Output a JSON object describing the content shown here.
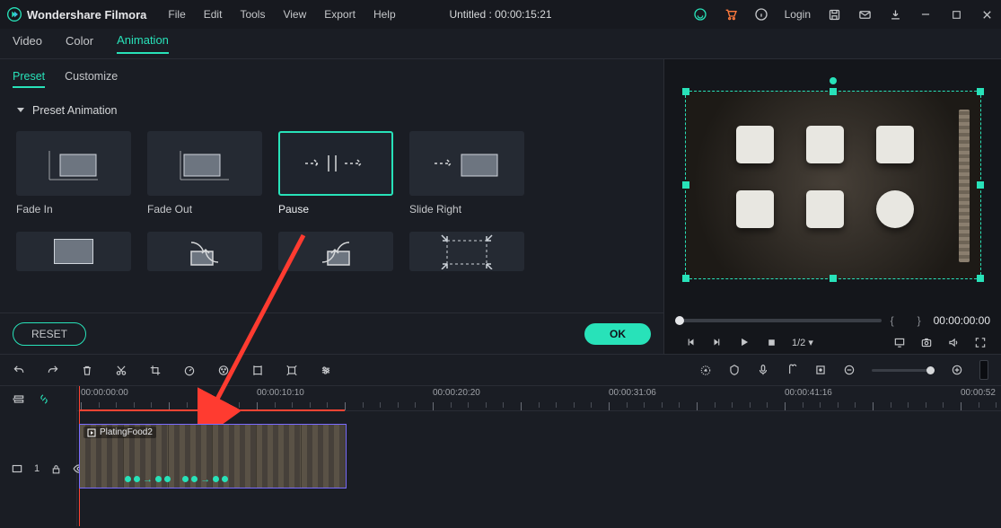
{
  "titlebar": {
    "app_name": "Wondershare Filmora",
    "menu": [
      "File",
      "Edit",
      "Tools",
      "View",
      "Export",
      "Help"
    ],
    "document_title": "Untitled : 00:00:15:21",
    "login": "Login"
  },
  "primary_tabs": {
    "video": "Video",
    "color": "Color",
    "animation": "Animation"
  },
  "subtabs": {
    "preset": "Preset",
    "customize": "Customize"
  },
  "section": {
    "preset_animation": "Preset Animation"
  },
  "presets": {
    "fade_in": "Fade In",
    "fade_out": "Fade Out",
    "pause": "Pause",
    "slide_right": "Slide Right"
  },
  "buttons": {
    "reset": "RESET",
    "ok": "OK"
  },
  "preview": {
    "time": "00:00:00:00",
    "page": "1/2"
  },
  "ruler": {
    "t0": "00:00:00:00",
    "t1": "00:00:10:10",
    "t2": "00:00:20:20",
    "t3": "00:00:31:06",
    "t4": "00:00:41:16",
    "t5": "00:00:52"
  },
  "clip": {
    "name": "PlatingFood2"
  },
  "track": {
    "label": "1"
  }
}
